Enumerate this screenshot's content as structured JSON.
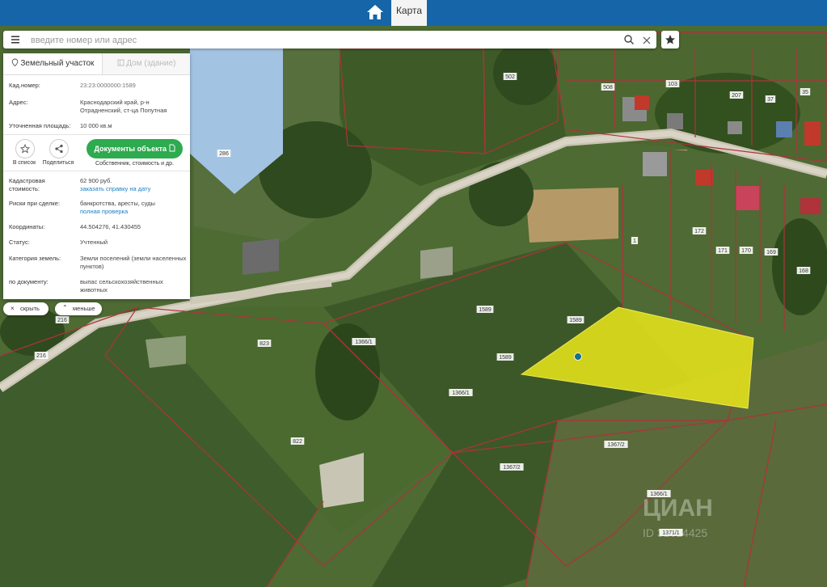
{
  "topbar": {
    "tab_label": "Карта"
  },
  "search": {
    "placeholder": "введите номер или адрес",
    "value": ""
  },
  "panel": {
    "tab_active": "Земельный участок",
    "tab_inactive": "Дом (здание)",
    "fields": [
      {
        "label": "Кад.номер:",
        "value": "23:23:0000000:1589",
        "link": ""
      },
      {
        "label": "Адрес:",
        "value": "Краснодарский край, р-н Отрадненский, ст-ца Попутная",
        "link": ""
      },
      {
        "label": "Уточненная площадь:",
        "value": "10 000 кв.м",
        "link": ""
      },
      {
        "label": "Кадастровая стоимость:",
        "value": "62 900 руб.",
        "link": "заказать справку на дату"
      },
      {
        "label": "Риски при сделке:",
        "value": "банкротства, аресты, суды",
        "link": "полная проверка"
      },
      {
        "label": "Координаты:",
        "value": "44.504276, 41.430455",
        "link": ""
      },
      {
        "label": "Статус:",
        "value": "Учтенный",
        "link": ""
      },
      {
        "label": "Категория земель:",
        "value": "Земли поселений (земли населенных пунктов)",
        "link": ""
      },
      {
        "label": "по документу:",
        "value": "выпас сельскохозяйственных животных",
        "link": ""
      }
    ],
    "add_list_label": "В список",
    "share_label": "Поделиться",
    "docs_button_label": "Документы объекта",
    "docs_sub": "Собственник, стоимость и др."
  },
  "pills": {
    "hide_label": "скрыть",
    "less_label": "меньше"
  },
  "map_labels": {
    "l286": "286",
    "l502": "502",
    "l508": "508",
    "l103": "103",
    "l207": "207",
    "l37": "37",
    "l35": "35",
    "l1": "1",
    "l172": "172",
    "l171": "171",
    "l170": "170",
    "l169": "169",
    "l168": "168",
    "l1589a": "1589",
    "l1589b": "1589",
    "l1589c": "1589",
    "l1366a": "1366/1",
    "l1366b": "1366/1",
    "l1366c": "1366/1",
    "l1367a": "1367/2",
    "l1367b": "1367/2",
    "l1371": "1371/1",
    "l823": "823",
    "l822": "822",
    "l216a": "216",
    "l216b": "216"
  },
  "watermark": {
    "brand": "ЦИАН",
    "id": "ID 31014425"
  },
  "colors": {
    "topbar": "#1565a8",
    "accent_green": "#2eaa4f",
    "parcel_highlight": "#e6e21a",
    "boundary": "#b0323a",
    "link": "#1a7fc1"
  }
}
